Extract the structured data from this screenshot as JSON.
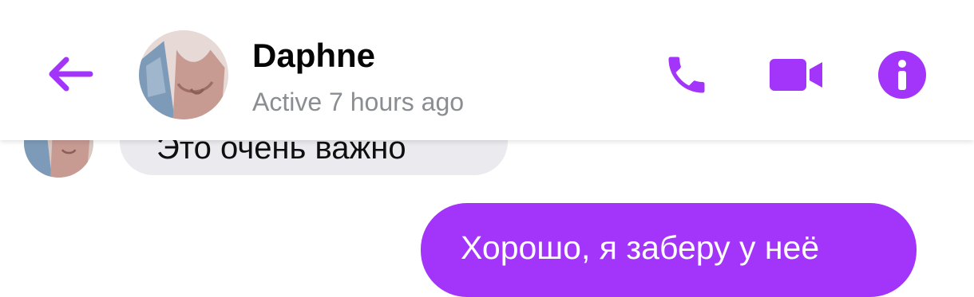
{
  "header": {
    "contact_name": "Daphne",
    "contact_status": "Active 7 hours ago",
    "icons": {
      "back": "arrow-left-icon",
      "call": "phone-icon",
      "video": "video-camera-icon",
      "info": "info-icon"
    }
  },
  "messages": [
    {
      "direction": "incoming",
      "text": "Это очень важно"
    },
    {
      "direction": "outgoing",
      "text": "Хорошо, я заберу у неё"
    }
  ],
  "colors": {
    "accent": "#a334fa",
    "incoming_bubble": "#ebebef",
    "status_text": "#8a8d91"
  }
}
